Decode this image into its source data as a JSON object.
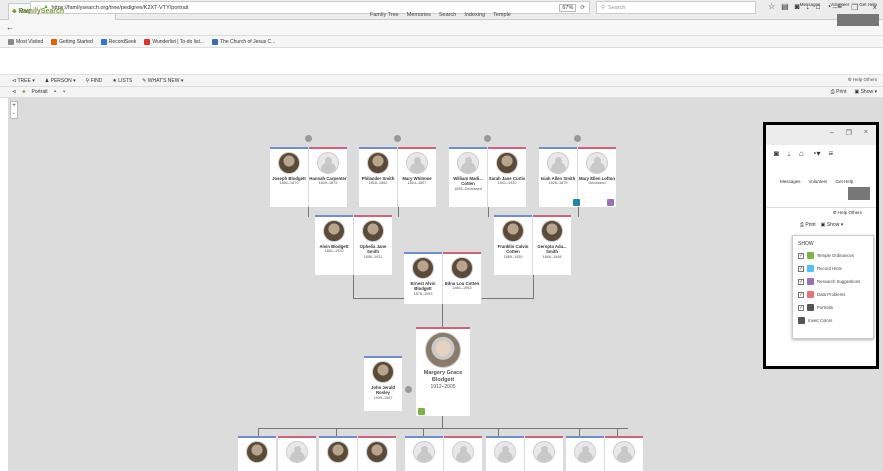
{
  "browser": {
    "tab_title": "Margery Grace Blodgett (1...",
    "url": "https://familysearch.org/tree/pedigree/K2XT-VTY/portrait",
    "zoom": "67%",
    "search_placeholder": "Search",
    "bookmarks": [
      {
        "label": "Most Visited",
        "color": "#8a8a8a"
      },
      {
        "label": "Getting Started",
        "color": "#e66000"
      },
      {
        "label": "RecordSeek",
        "color": "#2b7bd4"
      },
      {
        "label": "Wunderlist | To-do list...",
        "color": "#d33"
      },
      {
        "label": "The Church of Jesus C...",
        "color": "#3c6db3"
      }
    ]
  },
  "site": {
    "logo": "FamilySearch",
    "nav": [
      "Family Tree",
      "Memories",
      "Search",
      "Indexing",
      "Temple"
    ],
    "user_links": [
      "Messages",
      "Volunteer",
      "Get Help"
    ],
    "toolbar": [
      "TREE",
      "PERSON",
      "FIND",
      "LISTS",
      "WHAT'S NEW"
    ],
    "view_label": "Portrait",
    "help_others": "Help Others",
    "print": "Print",
    "show": "Show"
  },
  "tree": {
    "great_grandparents": [
      {
        "name": "Joseph Blodgett",
        "dates": "1851–1870",
        "g": "m",
        "photo": true
      },
      {
        "name": "Hannah Carpenter",
        "dates": "1809–1879",
        "g": "f",
        "photo": false
      },
      {
        "name": "Philander Smith",
        "dates": "1816–1862",
        "g": "m",
        "photo": true
      },
      {
        "name": "Mary Whitmoe",
        "dates": "1824–1897",
        "g": "f",
        "photo": false
      },
      {
        "name": "William Madi... Cotten",
        "dates": "1835–Deceased",
        "g": "m",
        "photo": false
      },
      {
        "name": "Sarah Jane Curtis",
        "dates": "1841–1920",
        "g": "f",
        "photo": true
      },
      {
        "name": "Isiah Allen Smith",
        "dates": "1826–1879",
        "g": "m",
        "photo": false
      },
      {
        "name": "Mary Ellen Lofton",
        "dates": "Deceased",
        "g": "f",
        "photo": false
      }
    ],
    "grandparents": [
      {
        "name": "Alvin Blodgett",
        "dates": "1861–1920",
        "g": "m",
        "photo": true
      },
      {
        "name": "Ophelia Jane Smith",
        "dates": "1856–1931",
        "g": "f",
        "photo": true
      },
      {
        "name": "Franklin Calvin Cotten",
        "dates": "1869–1939",
        "g": "m",
        "photo": true
      },
      {
        "name": "Geropta Ada... Smith",
        "dates": "1866–1948",
        "g": "f",
        "photo": true
      }
    ],
    "parents": [
      {
        "name": "Ernest Alvin Blodgett",
        "dates": "1878–1953",
        "g": "m",
        "photo": true
      },
      {
        "name": "Edna Lou Cotten",
        "dates": "1881–1963",
        "g": "f",
        "photo": true
      }
    ],
    "spouse": {
      "name": "John Jerald Rosley",
      "dates": "1909–1987"
    },
    "focus": {
      "name": "Margery Grace Blodgett",
      "dates": "1912–2005"
    }
  },
  "popup": {
    "links": [
      "Messages",
      "Volunteer",
      "Get Help"
    ],
    "help_others": "Help Others",
    "print": "Print",
    "show": "Show",
    "menu_title": "SHOW",
    "items": [
      {
        "label": "Temple Ordinances",
        "color": "#7cb342",
        "checked": true
      },
      {
        "label": "Record Hints",
        "color": "#4fc3f7",
        "checked": true
      },
      {
        "label": "Research Suggestions",
        "color": "#9c6fb6",
        "checked": true
      },
      {
        "label": "Data Problems",
        "color": "#e57373",
        "checked": true
      },
      {
        "label": "Portraits",
        "color": "#555555",
        "checked": true
      },
      {
        "label": "Invert Colors",
        "color": "#555555",
        "checked": false
      }
    ]
  }
}
